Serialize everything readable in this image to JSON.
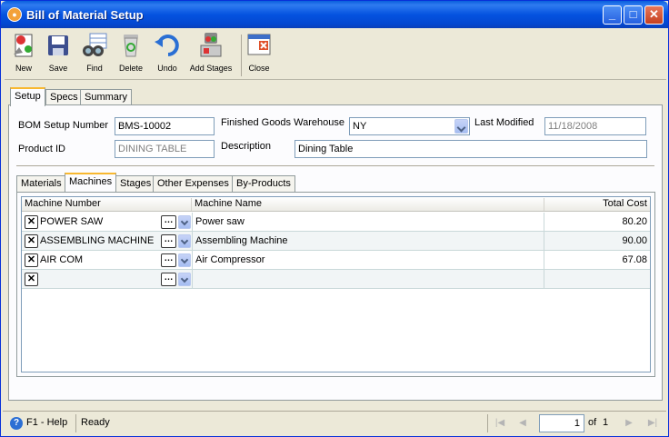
{
  "window": {
    "title": "Bill of Material Setup"
  },
  "toolbar": {
    "new": "New",
    "save": "Save",
    "find": "Find",
    "delete": "Delete",
    "undo": "Undo",
    "add_stages": "Add Stages",
    "close": "Close"
  },
  "tabs": [
    "Setup",
    "Specs",
    "Summary"
  ],
  "form": {
    "bom_setup_number_label": "BOM Setup Number",
    "bom_setup_number": "BMS-10002",
    "warehouse_label": "Finished Goods Warehouse",
    "warehouse": "NY",
    "last_modified_label": "Last Modified",
    "last_modified": "11/18/2008",
    "product_id_label": "Product ID",
    "product_id": "DINING TABLE",
    "description_label": "Description",
    "description": "Dining Table"
  },
  "inner_tabs": [
    "Materials",
    "Machines",
    "Stages",
    "Other Expenses",
    "By-Products"
  ],
  "grid": {
    "headers": {
      "machine_number": "Machine Number",
      "machine_name": "Machine Name",
      "total_cost": "Total Cost"
    },
    "rows": [
      {
        "machine_number": "POWER SAW",
        "machine_name": "Power saw",
        "total_cost": "80.20"
      },
      {
        "machine_number": "ASSEMBLING MACHINE",
        "machine_name": "Assembling Machine",
        "total_cost": "90.00"
      },
      {
        "machine_number": "AIR COM",
        "machine_name": "Air Compressor",
        "total_cost": "67.08"
      },
      {
        "machine_number": "",
        "machine_name": "",
        "total_cost": ""
      }
    ]
  },
  "status": {
    "help": "F1 - Help",
    "state": "Ready",
    "page": "1",
    "of": "of",
    "total_pages": "1"
  },
  "icons": {
    "new": "new-document-icon",
    "save": "floppy-disk-icon",
    "find": "binoculars-icon",
    "delete": "recycle-bin-icon",
    "undo": "undo-arrow-icon",
    "add_stages": "add-stages-icon",
    "close": "close-form-icon",
    "help": "help-icon"
  },
  "colors": {
    "title_bar": "#0553e0",
    "active_tab_accent": "#f8b830",
    "window_bg": "#ece9d8"
  }
}
